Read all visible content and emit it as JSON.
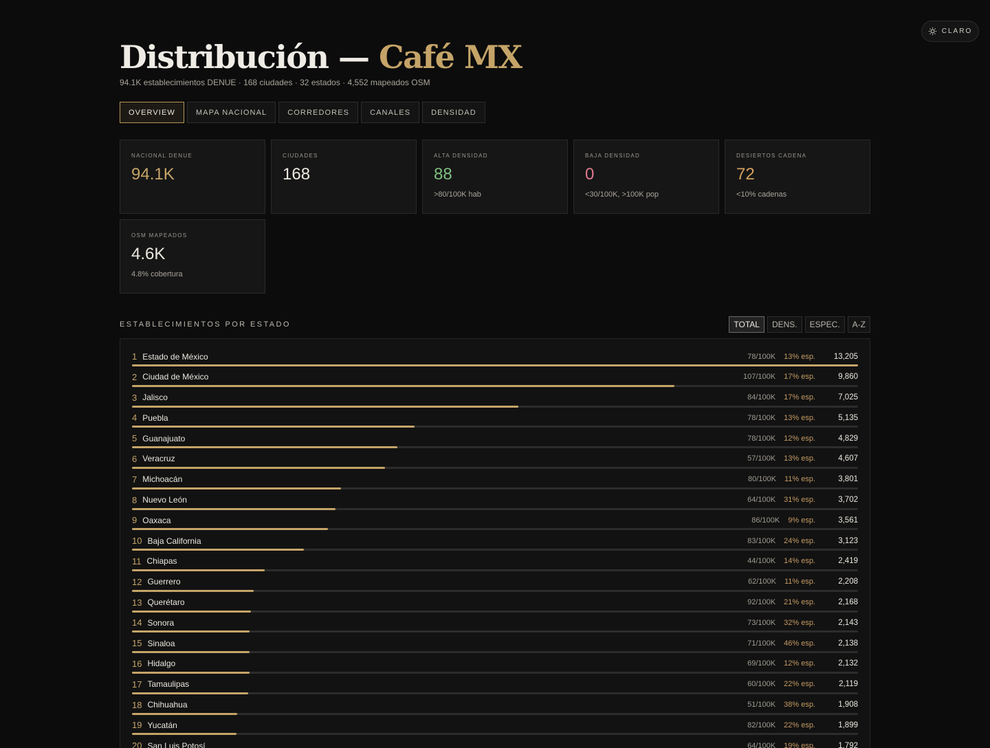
{
  "theme_toggle": {
    "label": "CLARO",
    "icon": "sun-icon"
  },
  "header": {
    "title_main": "Distribución —",
    "title_accent": "Café MX",
    "subtitle": "94.1K establecimientos DENUE · 168 ciudades · 32 estados · 4,552 mapeados OSM"
  },
  "tabs": [
    {
      "label": "OVERVIEW",
      "active": true
    },
    {
      "label": "MAPA NACIONAL",
      "active": false
    },
    {
      "label": "CORREDORES",
      "active": false
    },
    {
      "label": "CANALES",
      "active": false
    },
    {
      "label": "DENSIDAD",
      "active": false
    }
  ],
  "colors": {
    "gold": "#c5a468",
    "green": "#7fbf80",
    "pink": "#e07a8e",
    "orange": "#d4a05e"
  },
  "cards": [
    {
      "label": "NACIONAL DENUE",
      "value": "94.1K",
      "sub": "",
      "color": "#c5a468"
    },
    {
      "label": "CIUDADES",
      "value": "168",
      "sub": "",
      "color": "#ece8e0"
    },
    {
      "label": "ALTA DENSIDAD",
      "value": "88",
      "sub": ">80/100K hab",
      "color": "#7fbf80"
    },
    {
      "label": "BAJA DENSIDAD",
      "value": "0",
      "sub": "<30/100K, >100K pop",
      "color": "#e07a8e"
    },
    {
      "label": "DESIERTOS CADENA",
      "value": "72",
      "sub": "<10% cadenas",
      "color": "#d4a05e"
    },
    {
      "label": "OSM MAPEADOS",
      "value": "4.6K",
      "sub": "4.8% cobertura",
      "color": "#ece8e0"
    }
  ],
  "section": {
    "title": "ESTABLECIMIENTOS POR ESTADO",
    "sort_buttons": [
      {
        "label": "TOTAL",
        "active": true
      },
      {
        "label": "DENS.",
        "active": false
      },
      {
        "label": "ESPEC.",
        "active": false
      },
      {
        "label": "A-Z",
        "active": false
      }
    ]
  },
  "states": [
    {
      "rank": "1",
      "name": "Estado de México",
      "density": "78/100K",
      "esp": "13% esp.",
      "total": "13,205",
      "value": 13205
    },
    {
      "rank": "2",
      "name": "Ciudad de México",
      "density": "107/100K",
      "esp": "17% esp.",
      "total": "9,860",
      "value": 9860
    },
    {
      "rank": "3",
      "name": "Jalisco",
      "density": "84/100K",
      "esp": "17% esp.",
      "total": "7,025",
      "value": 7025
    },
    {
      "rank": "4",
      "name": "Puebla",
      "density": "78/100K",
      "esp": "13% esp.",
      "total": "5,135",
      "value": 5135
    },
    {
      "rank": "5",
      "name": "Guanajuato",
      "density": "78/100K",
      "esp": "12% esp.",
      "total": "4,829",
      "value": 4829
    },
    {
      "rank": "6",
      "name": "Veracruz",
      "density": "57/100K",
      "esp": "13% esp.",
      "total": "4,607",
      "value": 4607
    },
    {
      "rank": "7",
      "name": "Michoacán",
      "density": "80/100K",
      "esp": "11% esp.",
      "total": "3,801",
      "value": 3801
    },
    {
      "rank": "8",
      "name": "Nuevo León",
      "density": "64/100K",
      "esp": "31% esp.",
      "total": "3,702",
      "value": 3702
    },
    {
      "rank": "9",
      "name": "Oaxaca",
      "density": "86/100K",
      "esp": "9% esp.",
      "total": "3,561",
      "value": 3561
    },
    {
      "rank": "10",
      "name": "Baja California",
      "density": "83/100K",
      "esp": "24% esp.",
      "total": "3,123",
      "value": 3123
    },
    {
      "rank": "11",
      "name": "Chiapas",
      "density": "44/100K",
      "esp": "14% esp.",
      "total": "2,419",
      "value": 2419
    },
    {
      "rank": "12",
      "name": "Guerrero",
      "density": "62/100K",
      "esp": "11% esp.",
      "total": "2,208",
      "value": 2208
    },
    {
      "rank": "13",
      "name": "Querétaro",
      "density": "92/100K",
      "esp": "21% esp.",
      "total": "2,168",
      "value": 2168
    },
    {
      "rank": "14",
      "name": "Sonora",
      "density": "73/100K",
      "esp": "32% esp.",
      "total": "2,143",
      "value": 2143
    },
    {
      "rank": "15",
      "name": "Sinaloa",
      "density": "71/100K",
      "esp": "46% esp.",
      "total": "2,138",
      "value": 2138
    },
    {
      "rank": "16",
      "name": "Hidalgo",
      "density": "69/100K",
      "esp": "12% esp.",
      "total": "2,132",
      "value": 2132
    },
    {
      "rank": "17",
      "name": "Tamaulipas",
      "density": "60/100K",
      "esp": "22% esp.",
      "total": "2,119",
      "value": 2119
    },
    {
      "rank": "18",
      "name": "Chihuahua",
      "density": "51/100K",
      "esp": "38% esp.",
      "total": "1,908",
      "value": 1908
    },
    {
      "rank": "19",
      "name": "Yucatán",
      "density": "82/100K",
      "esp": "22% esp.",
      "total": "1,899",
      "value": 1899
    },
    {
      "rank": "20",
      "name": "San Luis Potosí",
      "density": "64/100K",
      "esp": "19% esp.",
      "total": "1,792",
      "value": 1792
    }
  ]
}
